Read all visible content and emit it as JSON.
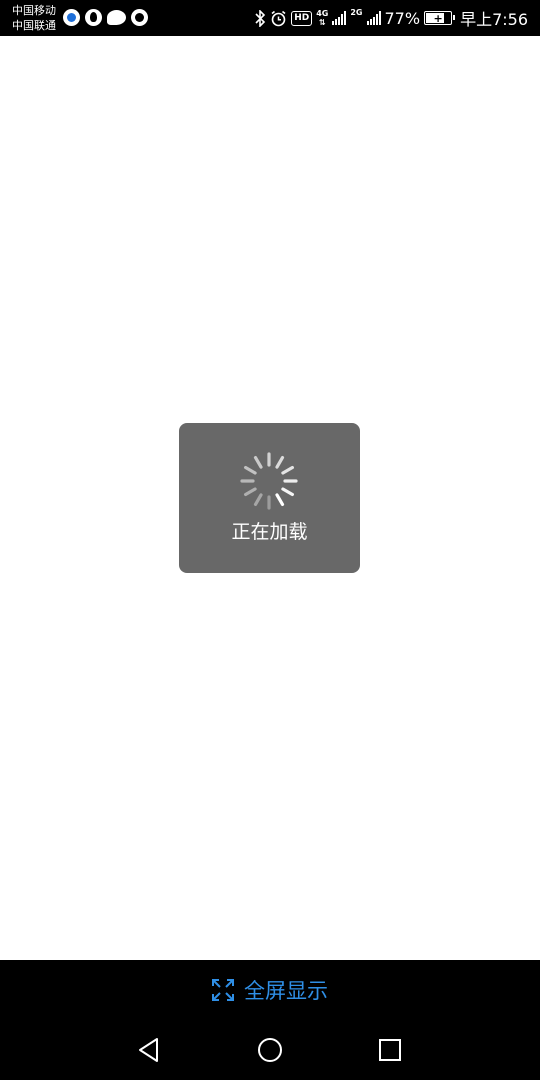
{
  "status_bar": {
    "carrier_1": "中国移动",
    "carrier_2": "中国联通",
    "app_icons": [
      "qq-icon",
      "browser-icon",
      "chat-icon",
      "qq-browser-icon"
    ],
    "hd_label": "HD",
    "network_1": {
      "top": "4G",
      "bottom": "⇅"
    },
    "network_2": {
      "top": "2G"
    },
    "battery_percent": "77%",
    "battery_level": 0.77,
    "time": "早上7:56"
  },
  "loading": {
    "text": "正在加载"
  },
  "fullscreen": {
    "label": "全屏显示",
    "accent_color": "#2f8fe6"
  },
  "navigation": {
    "items": [
      "back-button",
      "home-button",
      "recents-button"
    ]
  }
}
